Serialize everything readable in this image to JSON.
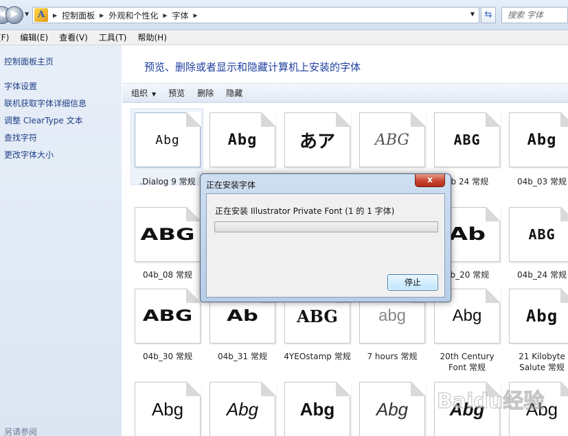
{
  "address": {
    "breadcrumbs": [
      "控制面板",
      "外观和个性化",
      "字体"
    ],
    "search_placeholder": "搜索 字体"
  },
  "menu": [
    "(F)",
    "编辑(E)",
    "查看(V)",
    "工具(T)",
    "帮助(H)"
  ],
  "sidebar": {
    "home": "控制面板主页",
    "links": [
      "字体设置",
      "联机获取字体详细信息",
      "调整 ClearType 文本",
      "查找字符",
      "更改字体大小"
    ],
    "footer": "另请参阅"
  },
  "main": {
    "title": "预览、删除或者显示和隐藏计算机上安装的字体",
    "toolbar": {
      "organize": "组织",
      "preview": "预览",
      "delete": "删除",
      "hide": "隐藏"
    }
  },
  "tiles": [
    {
      "sample": "Abg",
      "label": ".Dialog 9 常规"
    },
    {
      "sample": "Abg",
      "label": ""
    },
    {
      "sample": "あア",
      "label": ""
    },
    {
      "sample": "ABG",
      "label": ""
    },
    {
      "sample": "ABG",
      "label": "4b 24 常规"
    },
    {
      "sample": "Abg",
      "label": "04b_03 常规"
    },
    {
      "sample": "ABG",
      "label": "04b_08 常规"
    },
    {
      "sample": "Ab",
      "label": "4b_20 常规"
    },
    {
      "sample": "ABG",
      "label": "04b_24 常规"
    },
    {
      "sample": "ABG",
      "label": "04b_30 常规"
    },
    {
      "sample": "Ab",
      "label": "04b_31 常规"
    },
    {
      "sample": "ABG",
      "label": "4YEOstamp 常规"
    },
    {
      "sample": "abg",
      "label": "7 hours 常规"
    },
    {
      "sample": "Abg",
      "label": "20th Century Font 常规"
    },
    {
      "sample": "Abg",
      "label": "21 Kilobyte Salute 常规"
    },
    {
      "sample": "Abg",
      "label": ""
    },
    {
      "sample": "Abg",
      "label": ""
    },
    {
      "sample": "Abg",
      "label": ""
    },
    {
      "sample": "Abg",
      "label": ""
    },
    {
      "sample": "Abg",
      "label": ""
    },
    {
      "sample": "Abg",
      "label": ""
    }
  ],
  "dialog": {
    "title": "正在安装字体",
    "close": "x",
    "message": "正在安装 Illustrator Private Font (1 的 1 字体)",
    "progress": 0,
    "stop_button": "停止"
  },
  "watermark": "Baidu经验"
}
